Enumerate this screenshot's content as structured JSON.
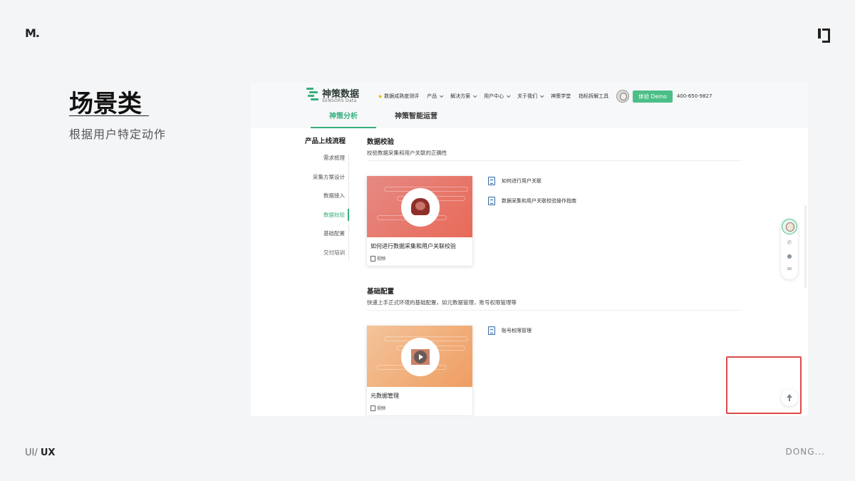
{
  "slide": {
    "logo": "M.",
    "title": "场景类",
    "subtitle": "根据用户特定动作",
    "footer_left_prefix": "UI/",
    "footer_left_main": "UX",
    "footer_right": "DONG..."
  },
  "brand": {
    "name": "神策数据",
    "sub": "SENSORS Data",
    "color": "#37b07c"
  },
  "nav": {
    "items": [
      {
        "label": "数据成熟度测评",
        "star": true,
        "chevron": false
      },
      {
        "label": "产品",
        "chevron": true
      },
      {
        "label": "解决方案",
        "chevron": true
      },
      {
        "label": "用户中心",
        "chevron": true
      },
      {
        "label": "关于我们",
        "chevron": true
      },
      {
        "label": "神策学堂",
        "chevron": false
      },
      {
        "label": "指标拆解工具",
        "chevron": false
      }
    ],
    "demo_button": "体验 Demo",
    "phone": "400-650-9827"
  },
  "subtabs": [
    {
      "label": "神策分析",
      "active": true
    },
    {
      "label": "神策智能运营",
      "active": false
    }
  ],
  "sidebar": {
    "title": "产品上线流程",
    "items": [
      {
        "label": "需求梳理",
        "active": false
      },
      {
        "label": "采集方案设计",
        "active": false
      },
      {
        "label": "数据接入",
        "active": false
      },
      {
        "label": "数据校验",
        "active": true
      },
      {
        "label": "基础配置",
        "active": false
      },
      {
        "label": "交付培训",
        "active": false
      }
    ]
  },
  "sections": [
    {
      "title": "数据校验",
      "desc": "校验数据采集和用户关联的正确性",
      "card": {
        "title": "如何进行数据采集和用户关联校验",
        "meta": "视频",
        "theme": "red"
      },
      "docs": [
        "如何进行用户关联",
        "数据采集和用户关联校验操作指南"
      ]
    },
    {
      "title": "基础配置",
      "desc": "快速上手正式环境的基础配置，如元数据管理，账号权限管理等",
      "card": {
        "title": "元数据管理",
        "meta": "视频",
        "theme": "orange"
      },
      "docs": [
        "账号权限管理"
      ]
    }
  ],
  "float_icons": [
    "avatar-icon",
    "phone-icon",
    "wechat-icon",
    "mail-icon"
  ],
  "back_top_icon": "arrow-up-icon",
  "highlight_color": "#dd4b4b"
}
